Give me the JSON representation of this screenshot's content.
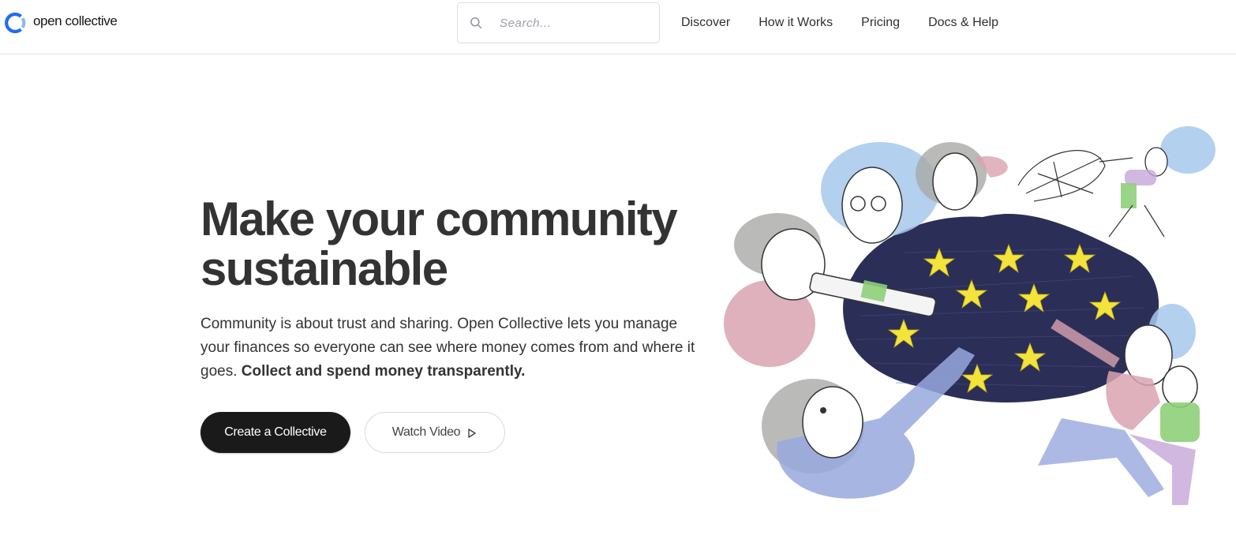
{
  "header": {
    "logo_text": "open collective",
    "search_placeholder": "Search...",
    "nav": [
      "Discover",
      "How it Works",
      "Pricing",
      "Docs & Help"
    ]
  },
  "hero": {
    "title_line1": "Make your community",
    "title_line2": "sustainable",
    "description": "Community is about trust and sharing. Open Collective lets you manage your finances so everyone can see where money comes from and where it goes.",
    "description_strong": "Collect and spend money transparently.",
    "primary_button": "Create a Collective",
    "secondary_button": "Watch Video"
  },
  "colors": {
    "brand": "#1869F5",
    "text": "#313233",
    "primary_button_bg": "#1a1a1a",
    "underline": "#c9e39a",
    "star": "#f5e63a",
    "night_sky": "#2b2f57"
  },
  "icons": [
    "logo-icon",
    "search-icon",
    "play-icon"
  ]
}
